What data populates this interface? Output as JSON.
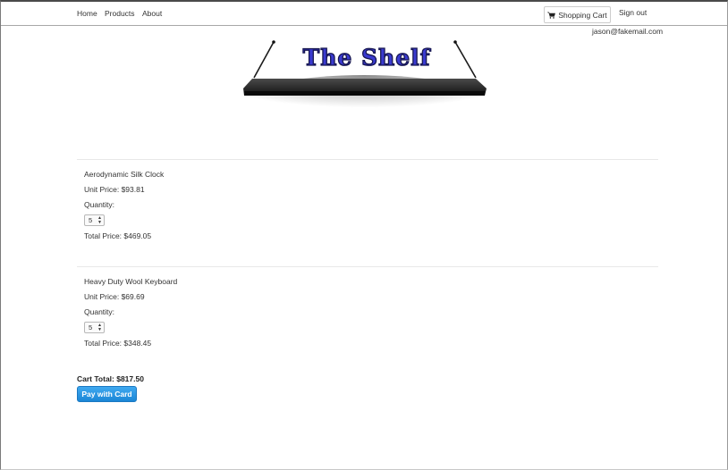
{
  "nav": {
    "home_label": "Home",
    "products_label": "Products",
    "about_label": "About",
    "cart_label": "Shopping Cart",
    "signout_label": "Sign out",
    "cart_icon": "shopping-cart-icon"
  },
  "user": {
    "email": "jason@fakemail.com"
  },
  "logo": {
    "text": "The Shelf"
  },
  "cart": {
    "unit_price_prefix": "Unit Price:",
    "quantity_label": "Quantity:",
    "total_price_prefix": "Total Price:",
    "items": [
      {
        "name": "Aerodynamic Silk Clock",
        "unit_price": "Unit Price: $93.81",
        "quantity_label": "Quantity:",
        "quantity": "5",
        "total_price": "Total Price: $469.05"
      },
      {
        "name": "Heavy Duty Wool Keyboard",
        "unit_price": "Unit Price: $69.69",
        "quantity_label": "Quantity:",
        "quantity": "5",
        "total_price": "Total Price: $348.45"
      }
    ],
    "total": "Cart Total: $817.50",
    "pay_label": "Pay with Card"
  },
  "colors": {
    "pay_button": "#1b86d6",
    "logo_text": "#3a3ad0"
  }
}
